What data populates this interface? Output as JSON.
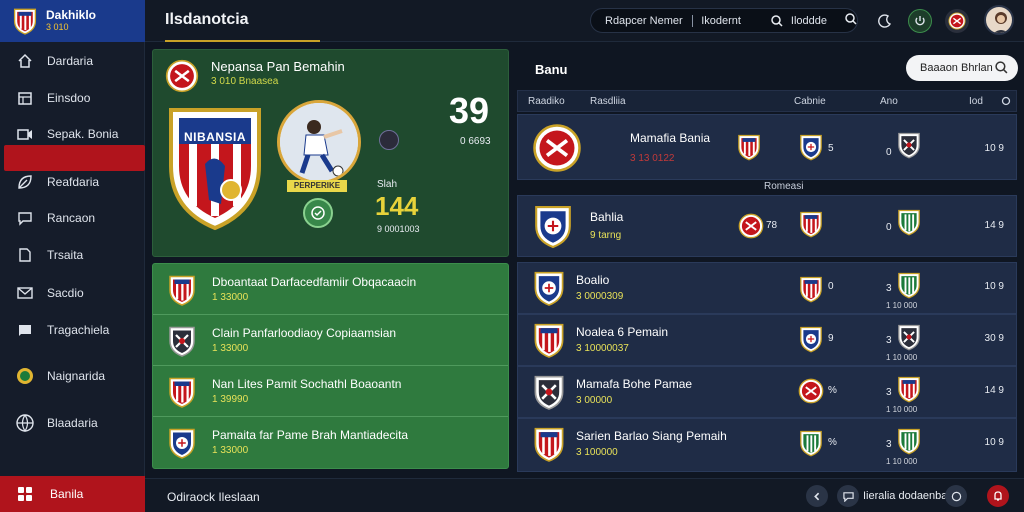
{
  "brand": {
    "title": "Dakhiklo",
    "subtitle": "3 010"
  },
  "topbar": {
    "title": "Ilsdanotcia",
    "search_seg1": "Rdapcer Nemer",
    "search_seg2": "Ikodernt",
    "search_seg3": "Iloddde",
    "icons": [
      "moon-icon",
      "power-icon",
      "club-badge-icon",
      "user-avatar"
    ]
  },
  "sidebar": {
    "items": [
      {
        "label": "Dardaria",
        "icon": "home-icon"
      },
      {
        "label": "Einsdoo",
        "icon": "calendar-icon"
      },
      {
        "label": "Sepak. Bonia",
        "icon": "video-icon"
      },
      {
        "label": "Reafdaria",
        "icon": "leaf-icon"
      },
      {
        "label": "Rancaon",
        "icon": "chat-icon"
      },
      {
        "label": "Trsaita",
        "icon": "document-icon"
      },
      {
        "label": "Sacdio",
        "icon": "mail-icon"
      },
      {
        "label": "Tragachiela",
        "icon": "message-icon"
      },
      {
        "label": "Naignarida",
        "icon": "club-logo-icon"
      },
      {
        "label": "Blaadaria",
        "icon": "globe-icon"
      }
    ],
    "footer_label": "Banila"
  },
  "featured": {
    "title": "Nepansa Pan Bemahin",
    "subtitle": "3 010 Bnaasea",
    "badge_text": "NIBANSIA",
    "score": "39",
    "score_label": "0 6693",
    "stat_label": "Slah",
    "stat_value": "144",
    "stat_sub": "9 0001003",
    "player_tag": "PERPERIKE"
  },
  "left_list": [
    {
      "title": "Dboantaat Darfacedfamiir Obqacaacin",
      "sub": "1 33000"
    },
    {
      "title": "Clain Panfarloodiaoy Copiaamsian",
      "sub": "1 33000"
    },
    {
      "title": "Nan Lites Pamit Sochathl Boaoantn",
      "sub": "1 39990"
    },
    {
      "title": "Pamaita far Pame Brah Mantiadecita",
      "sub": "1 33000"
    }
  ],
  "right_panel": {
    "title": "Banu",
    "search_placeholder": "Baaaon Bhrlan",
    "headers": [
      "Raadiko",
      "Rasdliia",
      "Cabnie",
      "Ano",
      "Iod"
    ],
    "divider_label": "Romeasi",
    "rows": [
      {
        "name": "Mamafia Bania",
        "sub": "3 13 0122",
        "n1": "5",
        "n2": "0",
        "right": "10 9"
      },
      {
        "name": "Bahlia",
        "sub": "9 tarng",
        "n1": "78",
        "n2": "0",
        "right": "14 9"
      },
      {
        "name": "Boalio",
        "sub": "3 0000309",
        "n1": "0",
        "n2": "3",
        "right": "10 9",
        "dots": "1 10 000"
      },
      {
        "name": "Noalea 6 Pemain",
        "sub": "3 10000037",
        "n1": "9",
        "n2": "3",
        "right": "30 9",
        "dots": "1 10 000"
      },
      {
        "name": "Mamafa Bohe Pamae",
        "sub": "3 00000",
        "n1": "%",
        "n2": "3",
        "right": "14 9",
        "dots": "1 10 000"
      },
      {
        "name": "Sarien Barlao Siang Pemaih",
        "sub": "3 100000",
        "n1": "%",
        "n2": "3",
        "right": "10 9",
        "dots": "1 10 000"
      }
    ]
  },
  "bottombar": {
    "label": "Odiraock Ileslaan",
    "right_label": "Iieralia dodaenbar"
  },
  "colors": {
    "accent_red": "#b0141c",
    "green_card": "#1f4a2e",
    "green_list": "#2f7a3e",
    "navy_row": "#1f2c46",
    "gold": "#c9a227"
  }
}
